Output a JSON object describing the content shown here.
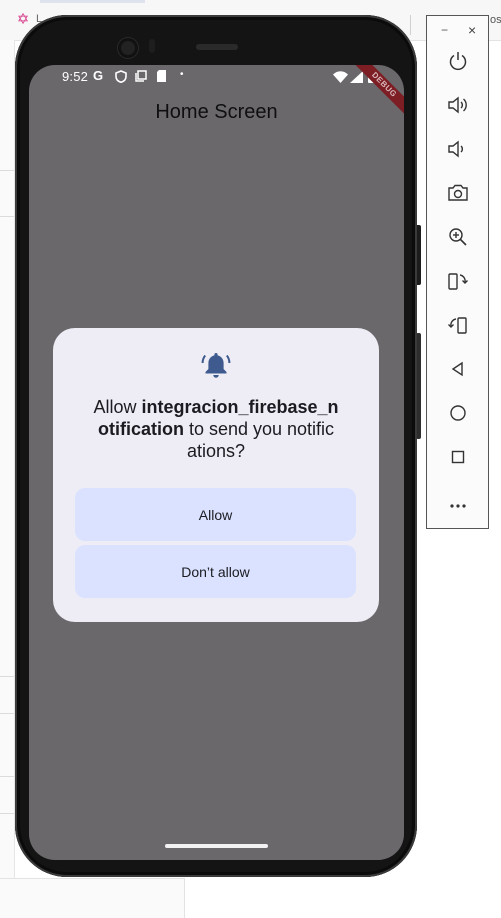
{
  "background": {
    "tab_text": "L",
    "right_text": "os"
  },
  "status_bar": {
    "time": "9:52",
    "icons": [
      "google-g-icon",
      "shield-icon",
      "screenshot-icon",
      "sd-card-icon",
      "notification-dot-icon",
      "wifi-icon",
      "cell-signal-icon",
      "battery-icon"
    ],
    "g_glyph": "G",
    "dot_glyph": "•"
  },
  "debug_banner": "DEBUG",
  "app": {
    "title": "Home Screen"
  },
  "permission_dialog": {
    "icon": "notification-bell-icon",
    "message_prefix": "Allow ",
    "app_name": "integracion_firebase_notification",
    "message_suffix": " to send you notifications?",
    "allow_label": "Allow",
    "deny_label": "Don’t allow"
  },
  "emulator_toolbar": {
    "minimize": "−",
    "close": "×",
    "buttons": [
      "power-icon",
      "volume-up-icon",
      "volume-down-icon",
      "camera-icon",
      "zoom-icon",
      "rotate-left-icon",
      "rotate-right-icon",
      "back-icon",
      "home-icon",
      "overview-icon",
      "more-icon"
    ]
  },
  "colors": {
    "screen_scrim": "#6b686c",
    "dialog_bg": "#eeedf5",
    "button_bg": "#dae2ff",
    "bell_icon": "#3e5a8e",
    "debug_banner": "#7d1d24"
  }
}
